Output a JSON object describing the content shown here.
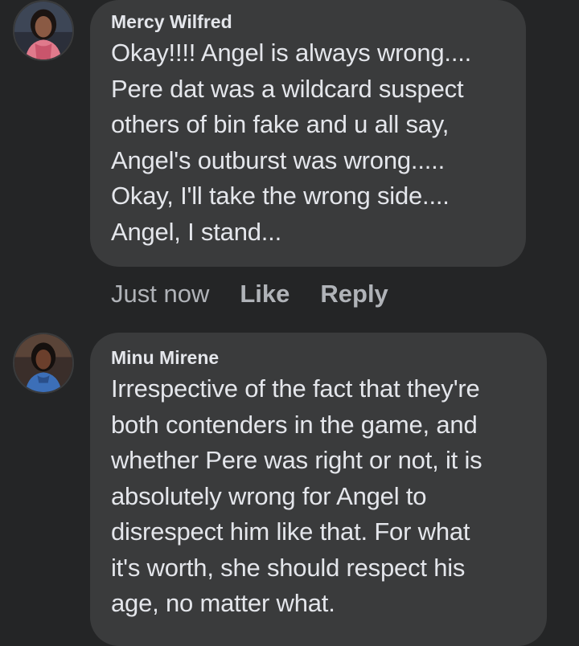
{
  "comments": [
    {
      "author": "Mercy Wilfred",
      "text": "Okay!!!! Angel is always wrong....\nPere dat was a wildcard suspect\nothers of bin fake and u all say,\nAngel's outburst was wrong.....\nOkay, I'll take the wrong side....\nAngel, I stand...",
      "timestamp": "Just now",
      "like_label": "Like",
      "reply_label": "Reply"
    },
    {
      "author": "Minu Mirene",
      "text": "Irrespective of the fact that they're\nboth contenders in the game, and\nwhether Pere was right or not, it is\nabsolutely wrong for Angel to\ndisrespect him like that. For what\nit's worth, she should respect his\nage, no matter what."
    }
  ],
  "colors": {
    "background": "#242526",
    "bubble": "#3a3b3c",
    "primary_text": "#e4e6eb",
    "secondary_text": "#b0b3b8"
  }
}
